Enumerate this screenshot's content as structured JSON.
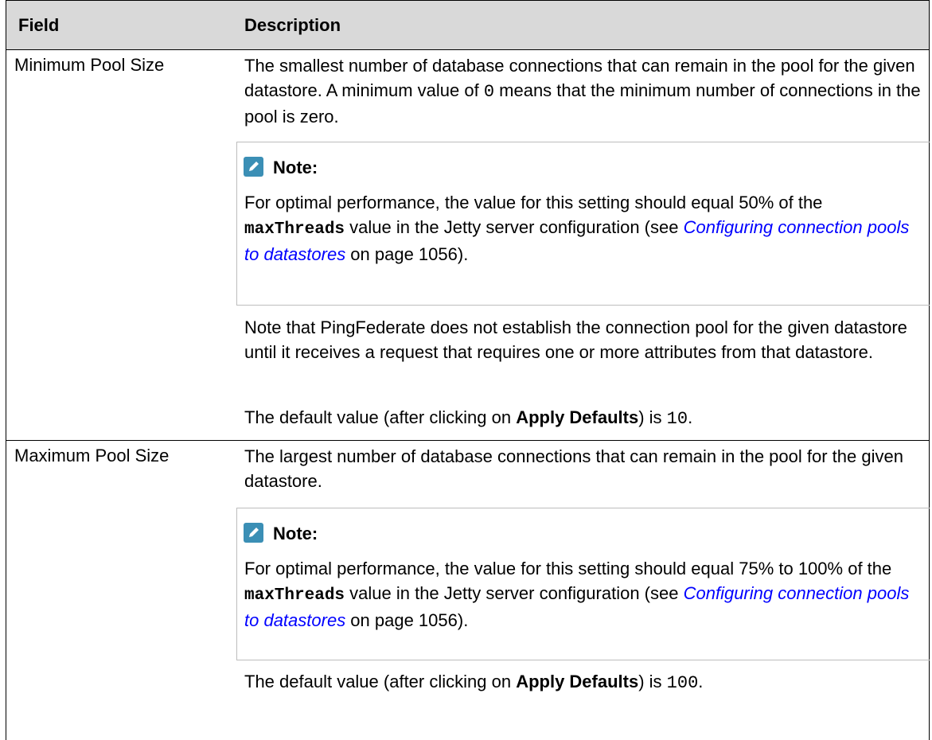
{
  "table": {
    "headers": {
      "field": "Field",
      "description": "Description"
    },
    "rows": [
      {
        "field": "Minimum Pool Size",
        "desc_p1_a": "The smallest number of database connections that can remain in the pool for the given datastore. A minimum value of ",
        "desc_p1_code": "0",
        "desc_p1_b": " means that the minimum number of connections in the pool is zero.",
        "note": {
          "title": "Note:",
          "text_a": "For optimal performance, the value for this setting should equal 50% of the ",
          "code": "maxThreads",
          "text_b": " value in the Jetty server configuration (see ",
          "link": "Configuring connection pools to datastores",
          "text_c": " on page 1056)."
        },
        "desc_p2": "Note that PingFederate does not establish the connection pool for the given datastore until it receives a request that requires one or more attributes from that datastore.",
        "default_a": "The default value (after clicking on ",
        "default_bold": "Apply Defaults",
        "default_b": ") is ",
        "default_code": "10",
        "default_end": "."
      },
      {
        "field": "Maximum Pool Size",
        "desc_p1": "The largest number of database connections that can remain in the pool for the given datastore.",
        "note": {
          "title": "Note:",
          "text_a": "For optimal performance, the value for this setting should equal 75% to 100% of the ",
          "code": "maxThreads",
          "text_b": " value in the Jetty server configuration (see ",
          "link": "Configuring connection pools to datastores",
          "text_c": " on page 1056)."
        },
        "default_a": "The default value (after clicking on ",
        "default_bold": "Apply Defaults",
        "default_b": ") is ",
        "default_code": "100",
        "default_end": "."
      }
    ]
  },
  "colors": {
    "header_bg": "#d9d9d9",
    "note_icon": "#3b8fb5",
    "link": "#0000ff"
  },
  "icons": {
    "note": "pencil-note-icon"
  }
}
